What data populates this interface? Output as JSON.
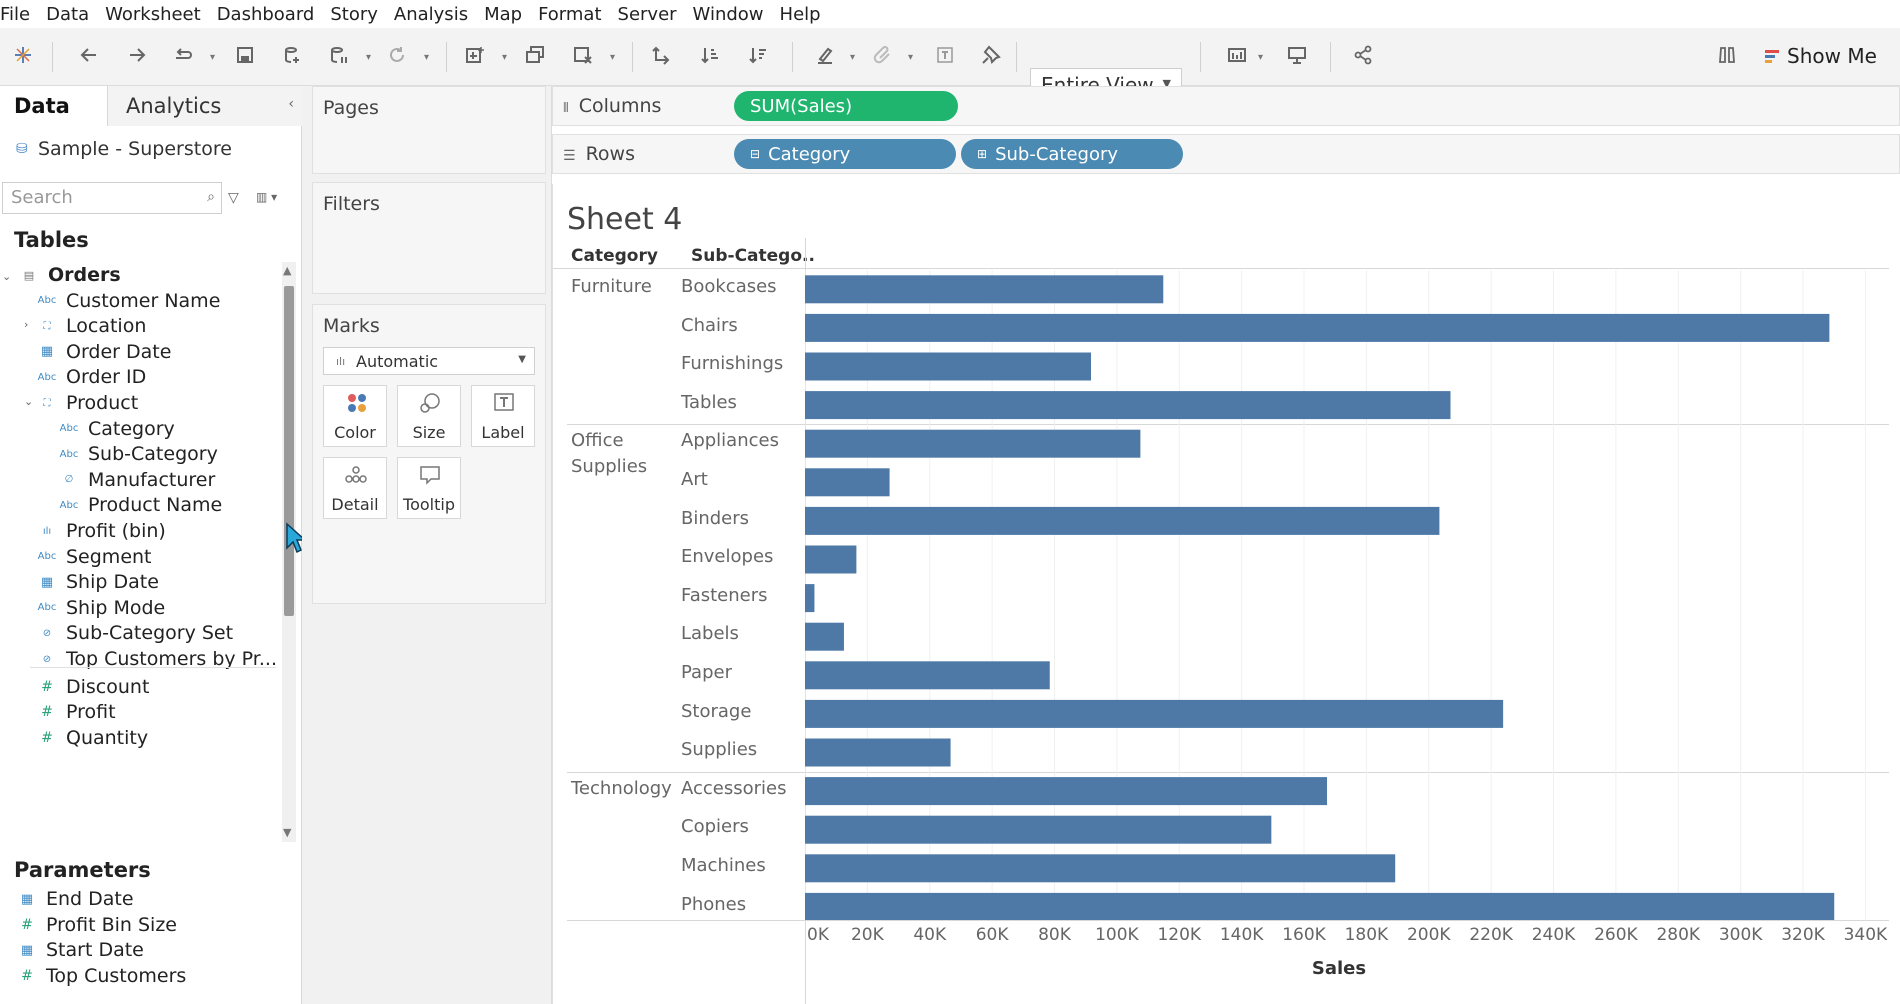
{
  "menubar": [
    "File",
    "Data",
    "Worksheet",
    "Dashboard",
    "Story",
    "Analysis",
    "Map",
    "Format",
    "Server",
    "Window",
    "Help"
  ],
  "toolbar": {
    "view_select": "Entire View",
    "show_me": "Show Me"
  },
  "data_pane": {
    "tab_data": "Data",
    "tab_analytics": "Analytics",
    "datasource": "Sample - Superstore",
    "search_placeholder": "Search",
    "tables_heading": "Tables",
    "table_name": "Orders",
    "fields": [
      {
        "label": "Customer Name",
        "type": "abc",
        "indent": 1
      },
      {
        "label": "Location",
        "type": "hier",
        "indent": 1,
        "expand": "right"
      },
      {
        "label": "Order Date",
        "type": "date",
        "indent": 1
      },
      {
        "label": "Order ID",
        "type": "abc",
        "indent": 1
      },
      {
        "label": "Product",
        "type": "hier",
        "indent": 1,
        "expand": "down"
      },
      {
        "label": "Category",
        "type": "abc",
        "indent": 2
      },
      {
        "label": "Sub-Category",
        "type": "abc",
        "indent": 2
      },
      {
        "label": "Manufacturer",
        "type": "link",
        "indent": 2
      },
      {
        "label": "Product Name",
        "type": "abc",
        "indent": 2
      },
      {
        "label": "Profit (bin)",
        "type": "bin",
        "indent": 1
      },
      {
        "label": "Segment",
        "type": "abc",
        "indent": 1
      },
      {
        "label": "Ship Date",
        "type": "date",
        "indent": 1
      },
      {
        "label": "Ship Mode",
        "type": "abc",
        "indent": 1
      },
      {
        "label": "Sub-Category Set",
        "type": "set",
        "indent": 1
      },
      {
        "label": "Top Customers by Pr...",
        "type": "set",
        "indent": 1
      },
      {
        "label": "Discount",
        "type": "num",
        "indent": 1
      },
      {
        "label": "Profit",
        "type": "num",
        "indent": 1
      },
      {
        "label": "Quantity",
        "type": "num",
        "indent": 1
      }
    ],
    "parameters_heading": "Parameters",
    "parameters": [
      {
        "label": "End Date",
        "type": "date"
      },
      {
        "label": "Profit Bin Size",
        "type": "num"
      },
      {
        "label": "Start Date",
        "type": "date"
      },
      {
        "label": "Top Customers",
        "type": "num"
      }
    ]
  },
  "cards": {
    "pages": "Pages",
    "filters": "Filters",
    "marks": "Marks",
    "marks_type": "Automatic",
    "mark_buttons": [
      "Color",
      "Size",
      "Label",
      "Detail",
      "Tooltip"
    ]
  },
  "shelves": {
    "columns_label": "Columns",
    "rows_label": "Rows",
    "columns_pill": "SUM(Sales)",
    "rows_pills": [
      "Category",
      "Sub-Category"
    ]
  },
  "sheet": {
    "title": "Sheet 4",
    "header_category": "Category",
    "header_subcategory": "Sub-Catego.."
  },
  "chart_data": {
    "type": "bar",
    "orientation": "horizontal",
    "xlabel": "Sales",
    "xlim": [
      0,
      345000
    ],
    "tick_values": [
      0,
      20000,
      40000,
      60000,
      80000,
      100000,
      120000,
      140000,
      160000,
      180000,
      200000,
      220000,
      240000,
      260000,
      280000,
      300000,
      320000,
      340000
    ],
    "tick_labels": [
      "0K",
      "20K",
      "40K",
      "60K",
      "80K",
      "100K",
      "120K",
      "140K",
      "160K",
      "180K",
      "200K",
      "220K",
      "240K",
      "260K",
      "280K",
      "300K",
      "320K",
      "340K"
    ],
    "bar_color": "#4e79a7",
    "groups": [
      {
        "category": "Furniture",
        "category_lines": [
          "Furniture"
        ],
        "subcategories": [
          "Bookcases",
          "Chairs",
          "Furnishings",
          "Tables"
        ],
        "values": [
          114880,
          328449,
          91705,
          206966
        ]
      },
      {
        "category": "Office Supplies",
        "category_lines": [
          "Office",
          "Supplies"
        ],
        "subcategories": [
          "Appliances",
          "Art",
          "Binders",
          "Envelopes",
          "Fasteners",
          "Labels",
          "Paper",
          "Storage",
          "Supplies"
        ],
        "values": [
          107532,
          27119,
          203413,
          16476,
          3024,
          12486,
          78479,
          223844,
          46674
        ]
      },
      {
        "category": "Technology",
        "category_lines": [
          "Technology"
        ],
        "subcategories": [
          "Accessories",
          "Copiers",
          "Machines",
          "Phones"
        ],
        "values": [
          167380,
          149528,
          189239,
          330007
        ]
      }
    ]
  }
}
